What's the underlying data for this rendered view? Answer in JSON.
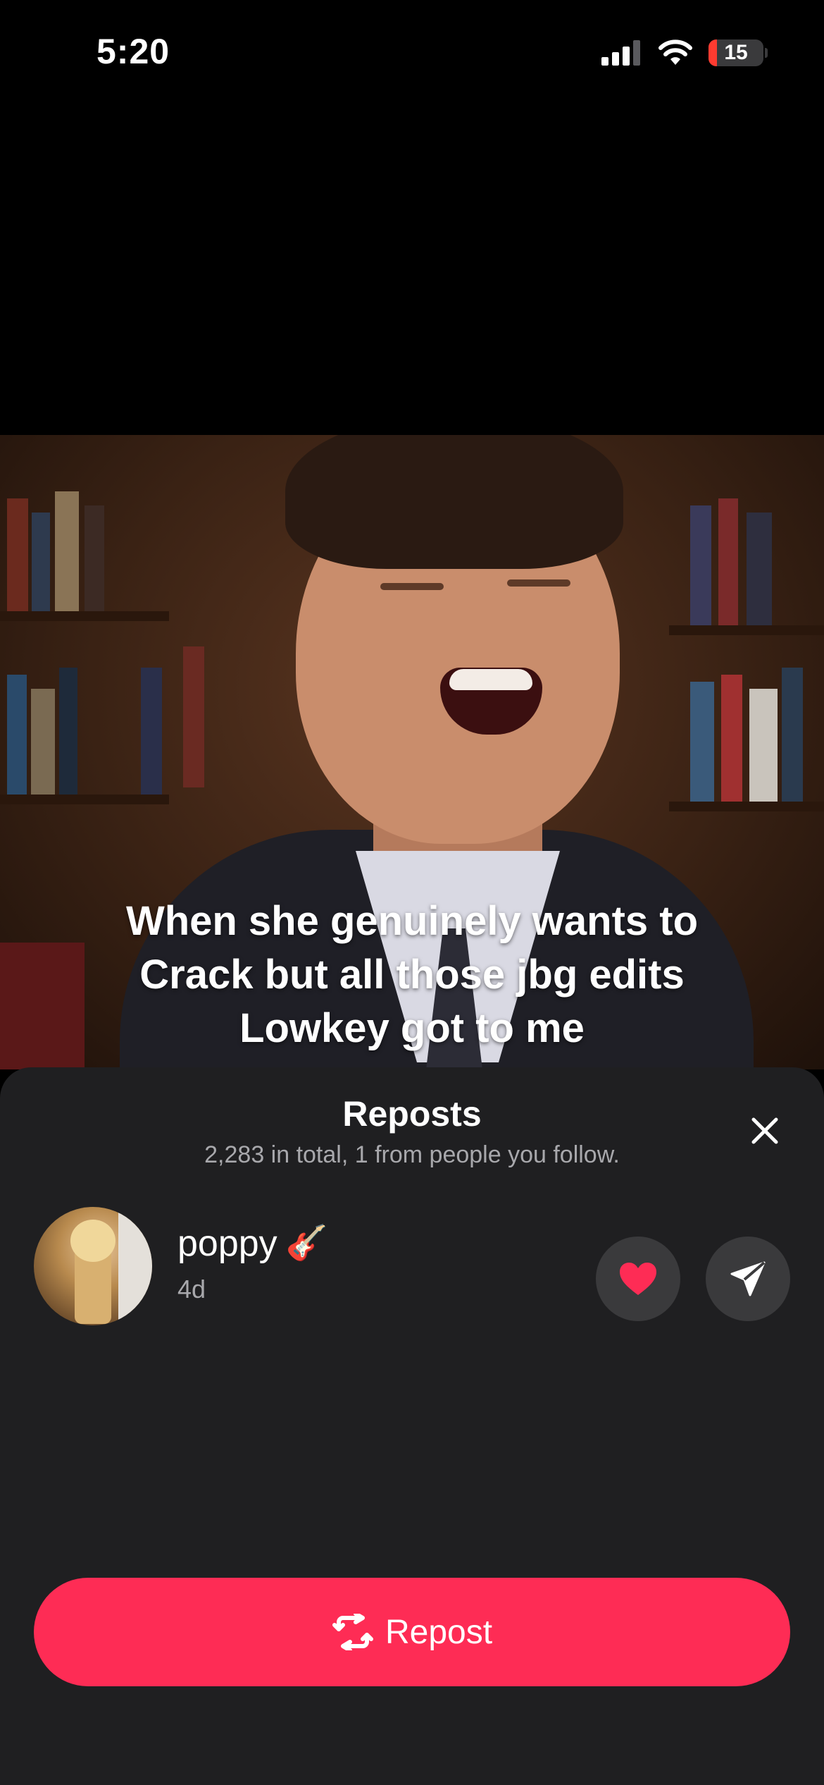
{
  "status_bar": {
    "time": "5:20",
    "battery_level": "15",
    "battery_color": "#ff3b30"
  },
  "video": {
    "caption_lines": [
      "When she genuinely wants to",
      "Crack but all those jbg edits",
      "Lowkey got to me"
    ]
  },
  "sheet": {
    "title": "Reposts",
    "subtitle": "2,283 in total, 1 from people you follow.",
    "close_icon": "close-icon"
  },
  "reposters": [
    {
      "username": "poppy",
      "emoji": "🎸",
      "time_ago": "4d",
      "actions": [
        "heart-icon",
        "send-icon"
      ]
    }
  ],
  "repost_button": {
    "label": "Repost",
    "icon": "repost-icon",
    "color": "#fe2c55"
  }
}
